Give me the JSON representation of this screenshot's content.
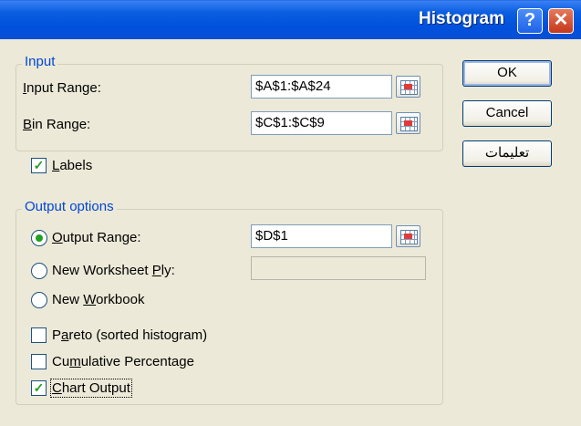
{
  "window": {
    "title": "Histogram"
  },
  "titlebar": {
    "help_icon": "question-mark-icon",
    "close_icon": "close-x-icon",
    "help_glyph": "?",
    "close_glyph": "✕"
  },
  "input_group": {
    "legend": "Input",
    "input_range": {
      "label_u": "I",
      "label_rest": "nput Range:",
      "value": "$A$1:$A$24"
    },
    "bin_range": {
      "label_u": "B",
      "label_rest": "in Range:",
      "value": "$C$1:$C$9"
    },
    "labels_checkbox": {
      "label_u": "L",
      "label_rest": "abels",
      "checked": true,
      "mark": "✓"
    }
  },
  "buttons": {
    "ok": "OK",
    "cancel": "Cancel",
    "help": "تعليمات"
  },
  "output_group": {
    "legend": "Output options",
    "output_range": {
      "label_u": "O",
      "label_rest": "utput Range:",
      "value": "$D$1",
      "selected": true
    },
    "new_worksheet": {
      "label_pre": "New Worksheet ",
      "label_u": "P",
      "label_rest": "ly:",
      "value": "",
      "selected": false
    },
    "new_workbook": {
      "label_pre": "New ",
      "label_u": "W",
      "label_rest": "orkbook",
      "selected": false
    },
    "pareto": {
      "label_u": "a",
      "label_pre": "P",
      "label_rest": "reto (sorted histogram)",
      "checked": false
    },
    "cumulative": {
      "label_pre": "Cu",
      "label_u": "m",
      "label_rest": "ulative Percentage",
      "checked": false
    },
    "chart_output": {
      "label_u": "C",
      "label_rest": "hart Output",
      "checked": true,
      "mark": "✓"
    }
  },
  "colors": {
    "titlebar": "#0a5ee0",
    "check_mark": "#21a121",
    "dialog_bg": "#ece9d8",
    "group_label": "#0046d5"
  }
}
